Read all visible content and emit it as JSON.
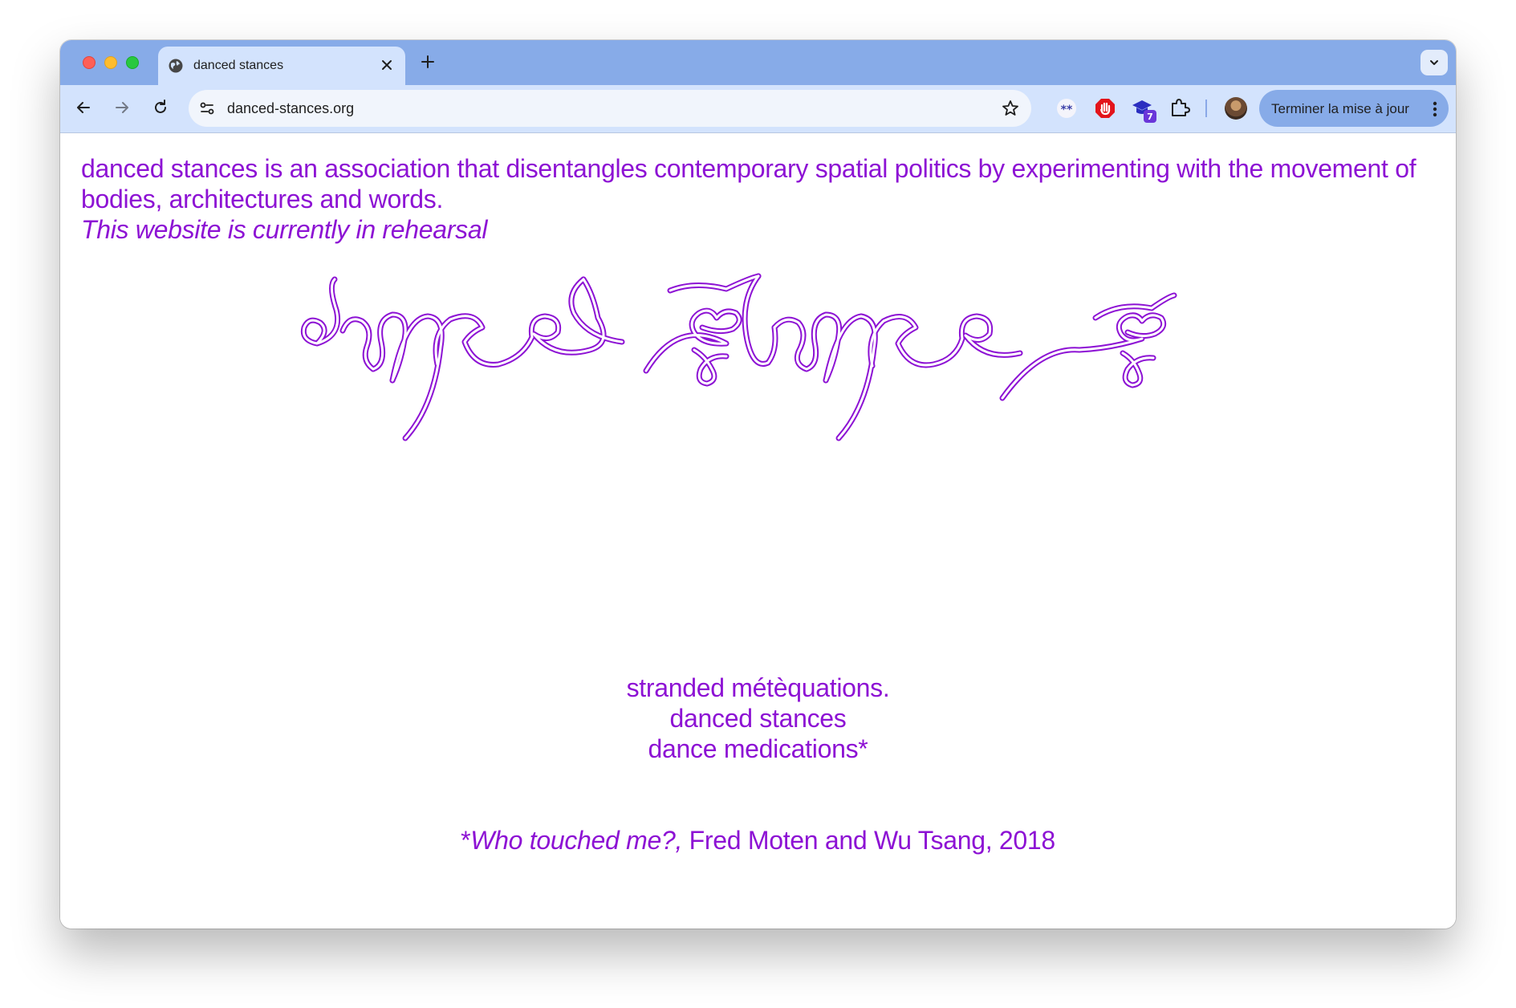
{
  "browser": {
    "tab": {
      "title": "danced stances"
    },
    "address_bar": {
      "url": "danced-stances.org"
    },
    "extensions": [
      {
        "icon": "asterisks-extension-icon"
      },
      {
        "icon": "stop-hand-extension-icon"
      },
      {
        "icon": "graduation-cap-extension-icon",
        "badge": "7"
      },
      {
        "icon": "puzzle-extensions-icon"
      }
    ],
    "update_button": {
      "label": "Terminer la mise à jour"
    },
    "accent_color": "#87abe8"
  },
  "page": {
    "text_color": "#8d12d4",
    "intro": "danced stances is an association that disentangles contemporary spatial politics by experimenting with the movement of bodies, architectures and words.",
    "status": "This website is currently in rehearsal",
    "logo_lettering": "danced stances",
    "lines": [
      "stranded métèquations.",
      "danced stances",
      "dance medications*"
    ],
    "quote": {
      "marker": "*",
      "title": "Who touched me?,",
      "rest": " Fred Moten and Wu Tsang, 2018"
    }
  }
}
